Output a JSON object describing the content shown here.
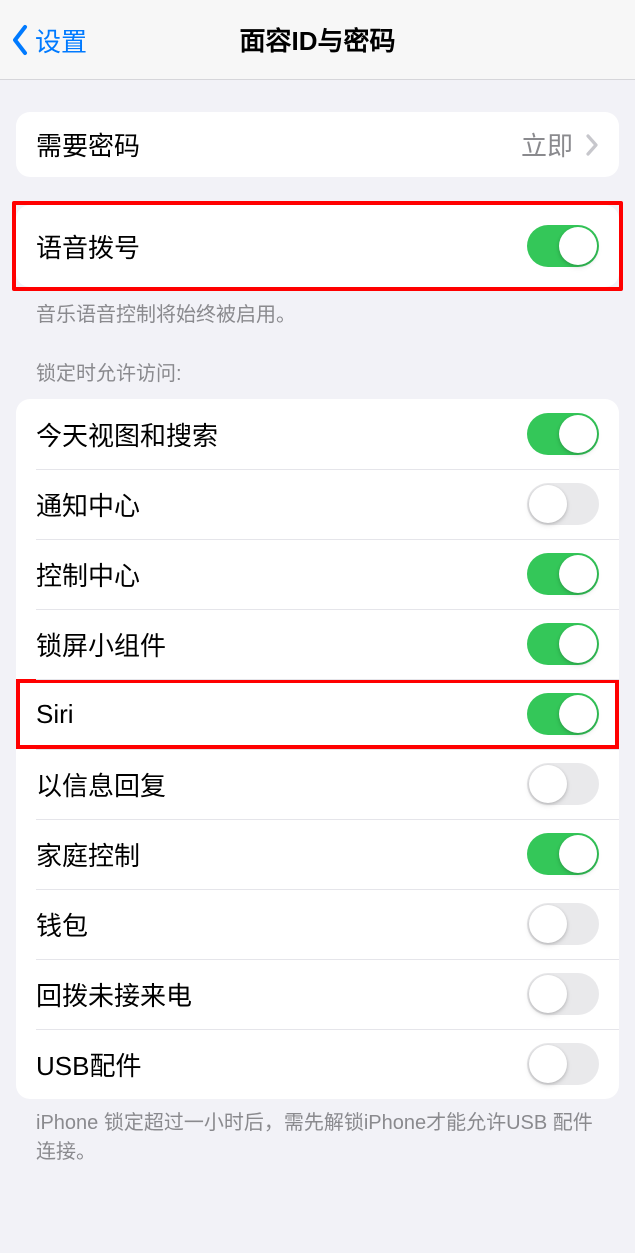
{
  "nav": {
    "back_label": "设置",
    "title": "面容ID与密码"
  },
  "passcode_req": {
    "label": "需要密码",
    "value": "立即"
  },
  "voice_dial": {
    "label": "语音拨号",
    "footer": "音乐语音控制将始终被启用。"
  },
  "lock_header": "锁定时允许访问:",
  "lock": {
    "today": "今天视图和搜索",
    "notification_center": "通知中心",
    "control_center": "控制中心",
    "widgets": "锁屏小组件",
    "siri": "Siri",
    "reply_msg": "以信息回复",
    "home": "家庭控制",
    "wallet": "钱包",
    "return_missed": "回拨未接来电",
    "usb": "USB配件"
  },
  "usb_footer": "iPhone 锁定超过一小时后，需先解锁iPhone才能允许USB 配件连接。"
}
